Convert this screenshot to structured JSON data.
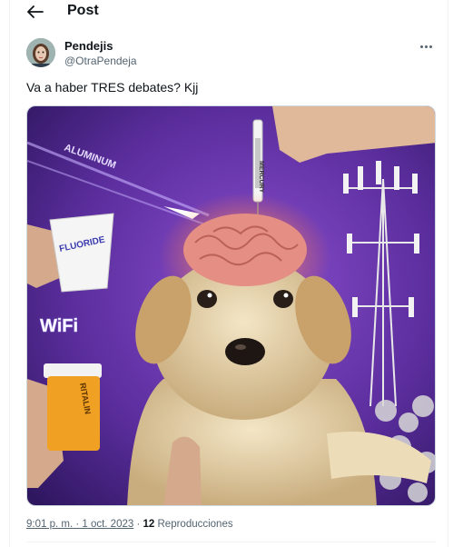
{
  "header": {
    "title": "Post",
    "back_icon": "arrow-left-icon"
  },
  "tweet": {
    "author_name": "Pendejis",
    "author_handle": "@OtraPendeja",
    "more_icon": "more-horizontal-icon",
    "text": "Va a haber TRES debates? Kjj",
    "image_labels": {
      "aluminum": "ALUMINUM",
      "mercury": "MERCURY",
      "fluoride": "FLUORIDE",
      "wifi": "WiFi",
      "ritalin": "RITALIN"
    },
    "timestamp": "9:01 p. m. · 1 oct. 2023",
    "separator": " · ",
    "view_count": "12",
    "view_label": " Reproducciones"
  },
  "colors": {
    "text": "#0f1419",
    "secondary": "#536471",
    "border": "#eff3f4",
    "image_bg": "#5a2d9c"
  }
}
